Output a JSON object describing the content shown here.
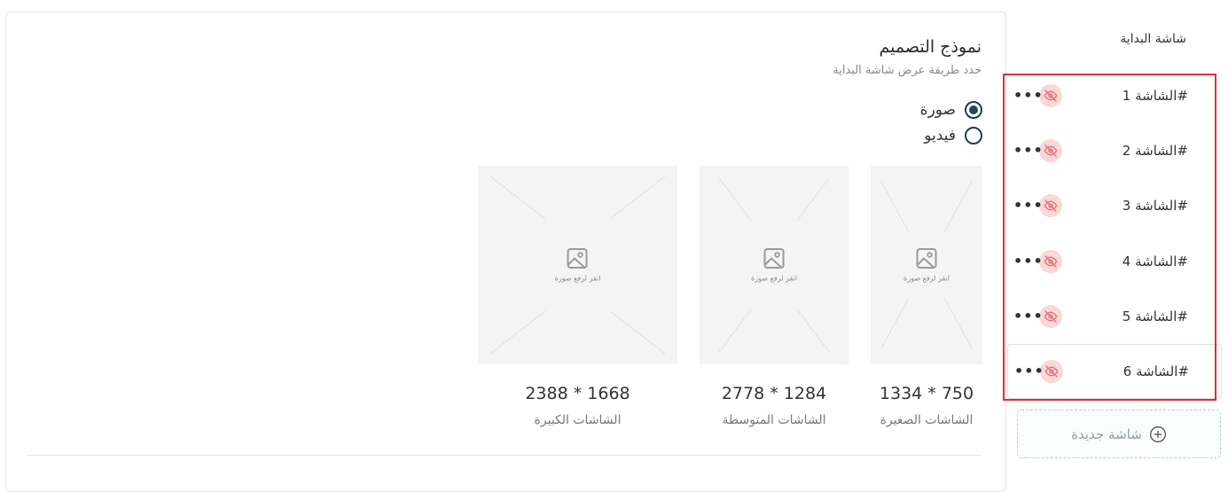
{
  "design": {
    "title": "نموذج التصميم",
    "subtitle": "حدد طريقة عرض شاشة البداية",
    "display_options": [
      {
        "label": "صورة",
        "selected": true
      },
      {
        "label": "فيديو",
        "selected": false
      }
    ],
    "upload_hint": "انقر لرفع صورة",
    "sizes": [
      {
        "dimensions": "1334 * 750",
        "label": "الشاشات الصغيرة"
      },
      {
        "dimensions": "2778 * 1284",
        "label": "الشاشات المتوسطة"
      },
      {
        "dimensions": "2388 * 1668",
        "label": "الشاشات الكبيرة"
      }
    ]
  },
  "sidebar": {
    "title": "شاشة البداية",
    "screens": [
      {
        "name": "الشاشة 1#"
      },
      {
        "name": "الشاشة 2#"
      },
      {
        "name": "الشاشة 3#"
      },
      {
        "name": "الشاشة 4#"
      },
      {
        "name": "الشاشة 5#"
      },
      {
        "name": "الشاشة 6#"
      }
    ],
    "new_screen_label": "شاشة جديدة"
  },
  "colors": {
    "accent": "#1f4a52",
    "hidden_badge": "#fbd7d7",
    "hidden_icon": "#e0707a",
    "selection_border": "#e03030",
    "new_button_border": "#a9d6d8"
  }
}
